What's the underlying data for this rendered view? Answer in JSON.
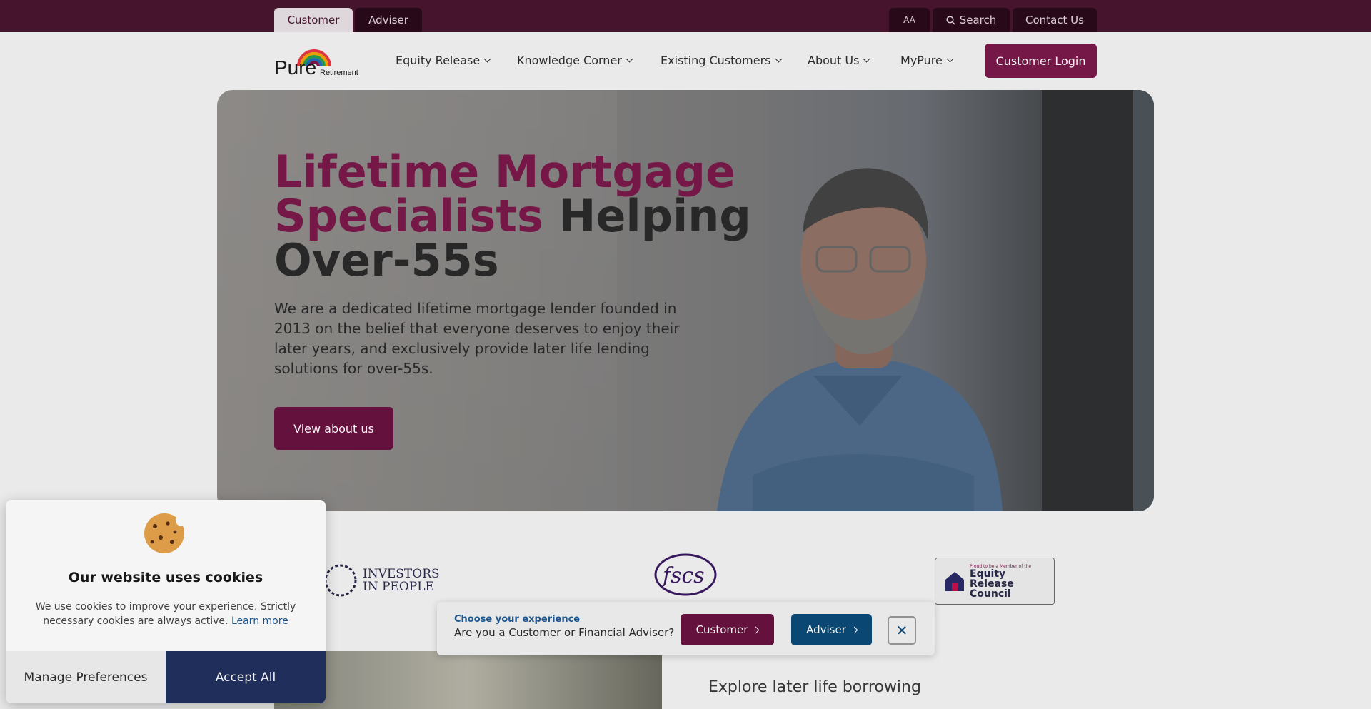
{
  "topbar": {
    "tabs": [
      {
        "label": "Customer",
        "active": true
      },
      {
        "label": "Adviser",
        "active": false
      }
    ],
    "text_size_label": "AA",
    "search_label": "Search",
    "contact_label": "Contact Us"
  },
  "nav": {
    "logo": {
      "brand": "Pure",
      "sub": "Retirement"
    },
    "items": [
      {
        "label": "Equity Release"
      },
      {
        "label": "Knowledge Corner"
      },
      {
        "label": "Existing Customers"
      },
      {
        "label": "About Us"
      },
      {
        "label": "MyPure"
      }
    ],
    "login_label": "Customer Login"
  },
  "hero": {
    "title_accent": "Lifetime Mortgage Specialists",
    "title_rest": "Helping Over-55s",
    "description": "We are a dedicated lifetime mortgage lender founded in 2013 on the belief that everyone deserves to enjoy their later years, and exclusively provide later life lending solutions for over-55s.",
    "cta_label": "View about us"
  },
  "accreditations": {
    "iip": "INVESTORS IN PEOPLE",
    "fscs": "fscs",
    "erc_small": "Proud to be a Member of the",
    "erc_main": "Equity Release Council"
  },
  "experience": {
    "label": "Choose your experience",
    "question": "Are you a Customer or Financial Adviser?",
    "customer_label": "Customer",
    "adviser_label": "Adviser",
    "close_glyph": "✕"
  },
  "cookie": {
    "title": "Our website uses cookies",
    "text": "We use cookies to improve your experience. Strictly necessary cookies are always active.",
    "link": "Learn more",
    "manage_label": "Manage Preferences",
    "accept_label": "Accept All"
  },
  "lower": {
    "heading": "Explore later life borrowing"
  },
  "colors": {
    "brand_plum": "#7a1a4a",
    "topbar": "#4a1530",
    "adviser_blue": "#0c4a78",
    "accept_navy": "#223060"
  }
}
